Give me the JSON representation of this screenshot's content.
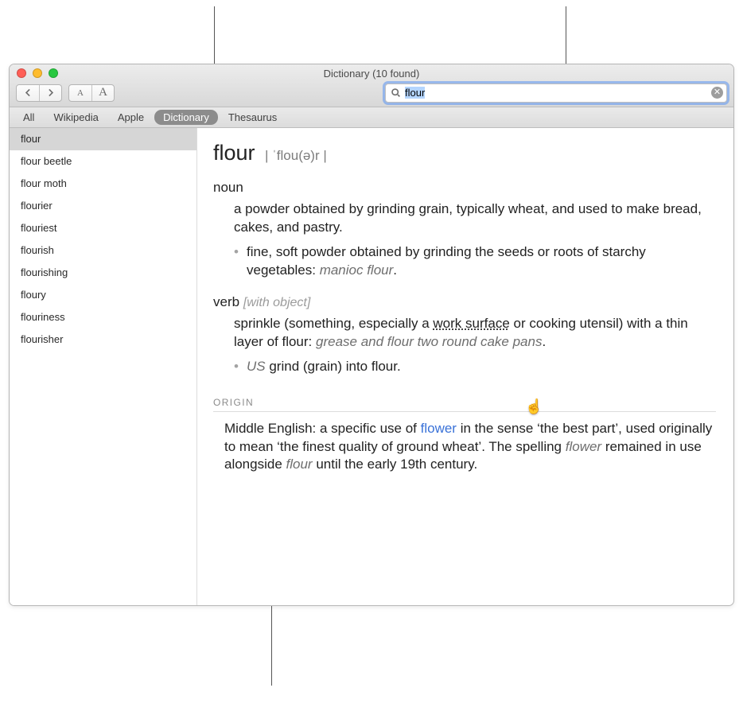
{
  "window": {
    "title": "Dictionary (10 found)"
  },
  "search": {
    "value": "flour"
  },
  "sources": [
    {
      "label": "All",
      "active": false
    },
    {
      "label": "Wikipedia",
      "active": false
    },
    {
      "label": "Apple",
      "active": false
    },
    {
      "label": "Dictionary",
      "active": true
    },
    {
      "label": "Thesaurus",
      "active": false
    }
  ],
  "sidebar": {
    "items": [
      "flour",
      "flour beetle",
      "flour moth",
      "flourier",
      "flouriest",
      "flourish",
      "flourishing",
      "floury",
      "flouriness",
      "flourisher"
    ],
    "selected_index": 0
  },
  "entry": {
    "headword": "flour",
    "pronunciation": "| ˈflou(ə)r |",
    "senses": [
      {
        "pos": "noun",
        "grammar": "",
        "definition": "a powder obtained by grinding grain, typically wheat, and used to make bread, cakes, and pastry.",
        "sub": {
          "text_before": "fine, soft powder obtained by grinding the seeds or roots of starchy vegetables: ",
          "example": "manioc flour",
          "text_after": "."
        }
      },
      {
        "pos": "verb",
        "grammar": "[with object]",
        "definition_pre": "sprinkle (something, especially a ",
        "xref": "work surface",
        "definition_mid": " or cooking utensil) with a thin layer of flour: ",
        "example": "grease and flour two round cake pans",
        "definition_post": ".",
        "sub": {
          "region": "US",
          "text": " grind (grain) into flour."
        }
      }
    ],
    "origin_label": "ORIGIN",
    "origin": {
      "t1": "Middle English: a specific use of ",
      "link": "flower",
      "t2": " in the sense ‘the best part’, used originally to mean ‘the finest quality of ground wheat’. The spelling ",
      "i1": "flower",
      "t3": " remained in use alongside ",
      "i2": "flour",
      "t4": " until the early 19th century."
    }
  }
}
